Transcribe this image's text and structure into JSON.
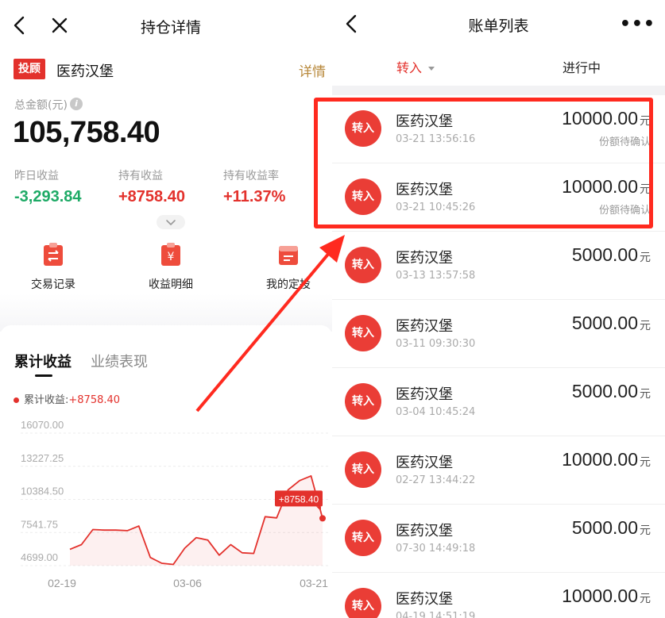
{
  "left": {
    "title": "持仓详情",
    "badge": "投顾",
    "fund_name": "医药汉堡",
    "detail_link": "详情",
    "total_label": "总金额(元)",
    "info_icon_glyph": "i",
    "total_value": "105,758.40",
    "stats": [
      {
        "label": "昨日收益",
        "value": "-3,293.84",
        "color": "#1eaa66"
      },
      {
        "label": "持有收益",
        "value": "+8758.40",
        "color": "#e3312c"
      },
      {
        "label": "持有收益率",
        "value": "+11.37%",
        "color": "#e3312c"
      }
    ],
    "shortcuts": [
      {
        "label": "交易记录",
        "icon": "transfer-icon"
      },
      {
        "label": "收益明细",
        "icon": "yuan-icon"
      },
      {
        "label": "我的定投",
        "icon": "calendar-icon"
      }
    ],
    "tabs": {
      "active": "累计收益",
      "inactive": "业绩表现"
    },
    "legend_label": "累计收益:",
    "legend_value": "+8758.40"
  },
  "chart_data": {
    "type": "area",
    "yticks": [
      "16070.00",
      "13227.25",
      "10384.50",
      "7541.75",
      "4699.00"
    ],
    "xticks": [
      "02-19",
      "03-06",
      "03-21"
    ],
    "ylim": [
      4699.0,
      16070.0
    ],
    "values": [
      6100,
      6500,
      7800,
      7750,
      7750,
      7700,
      8100,
      5400,
      4900,
      4800,
      6200,
      7100,
      6900,
      5600,
      6500,
      5800,
      5750,
      8900,
      8800,
      11200,
      12000,
      12400,
      8758.4
    ],
    "tooltip": "+8758.40",
    "line_color": "#e3312c",
    "grid": true
  },
  "right": {
    "title": "账单列表",
    "more_glyph": "•••",
    "filter_type": "转入",
    "filter_status": "进行中",
    "bills": [
      {
        "icon_label": "转入",
        "name": "医药汉堡",
        "time": "03-21 13:56:16",
        "amount": "10000.00",
        "unit": "元",
        "status": "份额待确认"
      },
      {
        "icon_label": "转入",
        "name": "医药汉堡",
        "time": "03-21 10:45:26",
        "amount": "10000.00",
        "unit": "元",
        "status": "份额待确认"
      },
      {
        "icon_label": "转入",
        "name": "医药汉堡",
        "time": "03-13 13:57:58",
        "amount": "5000.00",
        "unit": "元",
        "status": ""
      },
      {
        "icon_label": "转入",
        "name": "医药汉堡",
        "time": "03-11 09:30:30",
        "amount": "5000.00",
        "unit": "元",
        "status": ""
      },
      {
        "icon_label": "转入",
        "name": "医药汉堡",
        "time": "03-04 10:45:24",
        "amount": "5000.00",
        "unit": "元",
        "status": ""
      },
      {
        "icon_label": "转入",
        "name": "医药汉堡",
        "time": "02-27 13:44:22",
        "amount": "10000.00",
        "unit": "元",
        "status": ""
      },
      {
        "icon_label": "转入",
        "name": "医药汉堡",
        "time": "07-30 14:49:18",
        "amount": "5000.00",
        "unit": "元",
        "status": ""
      },
      {
        "icon_label": "转入",
        "name": "医药汉堡",
        "time": "04-19 14:51:19",
        "amount": "10000.00",
        "unit": "元",
        "status": ""
      }
    ]
  },
  "overlay": {
    "color": "#ff2a1f"
  }
}
